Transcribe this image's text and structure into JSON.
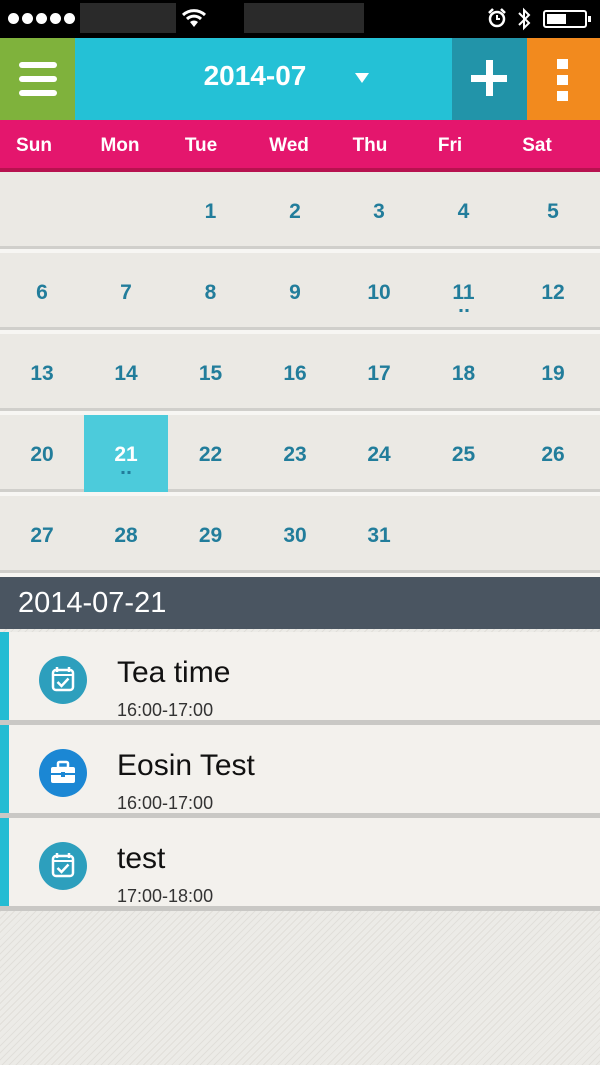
{
  "header": {
    "month": "2014-07",
    "icons": {
      "menu": "hamburger-icon",
      "dropdown": "caret-down-icon",
      "add": "plus-icon",
      "more": "kebab-menu-icon"
    },
    "colors": {
      "menu": "#7fb23c",
      "title": "#24c1d6",
      "add": "#2294a9",
      "more": "#f28a1e"
    }
  },
  "weekdays": [
    "Sun",
    "Mon",
    "Tue",
    "Wed",
    "Thu",
    "Fri",
    "Sat"
  ],
  "calendar": {
    "weeks": [
      [
        "",
        "",
        "1",
        "2",
        "3",
        "4",
        "5"
      ],
      [
        "6",
        "7",
        "8",
        "9",
        "10",
        "11",
        "12"
      ],
      [
        "13",
        "14",
        "15",
        "16",
        "17",
        "18",
        "19"
      ],
      [
        "20",
        "21",
        "22",
        "23",
        "24",
        "25",
        "26"
      ],
      [
        "27",
        "28",
        "29",
        "30",
        "31",
        "",
        ""
      ]
    ],
    "selected_day": "21",
    "days_with_events": [
      "11",
      "21"
    ]
  },
  "selected_date": "2014-07-21",
  "events": [
    {
      "title": "Tea time",
      "time": "16:00-17:00",
      "icon": "calendar-check-icon"
    },
    {
      "title": "Eosin Test",
      "time": "16:00-17:00",
      "icon": "briefcase-icon"
    },
    {
      "title": "test",
      "time": "17:00-18:00",
      "icon": "calendar-check-icon"
    }
  ],
  "status_bar": {
    "icons": [
      "signal-icon",
      "wifi-icon",
      "alarm-icon",
      "bluetooth-icon",
      "battery-icon"
    ]
  }
}
